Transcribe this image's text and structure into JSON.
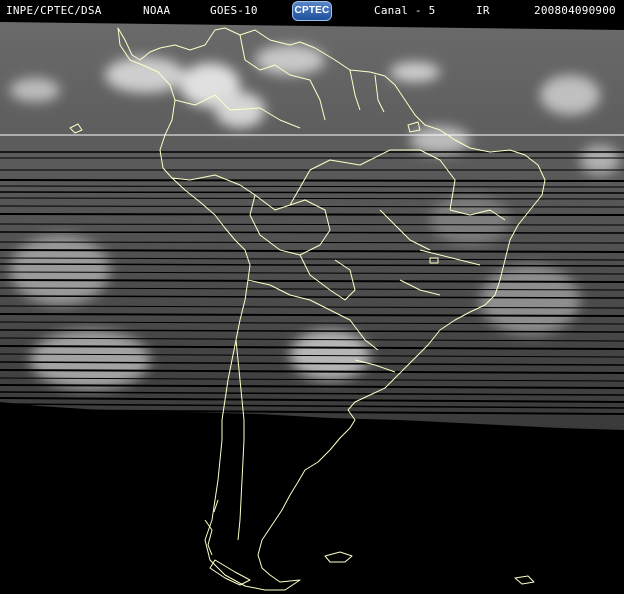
{
  "header": {
    "source": "INPE/CPTEC/DSA",
    "agency": "NOAA",
    "satellite": "GOES-10",
    "logo_text": "CPTEC",
    "channel": "Canal - 5",
    "band": "IR",
    "timestamp": "200804090900"
  },
  "colors": {
    "background": "#000000",
    "borders": "#ffffc8",
    "text": "#ffffff"
  }
}
